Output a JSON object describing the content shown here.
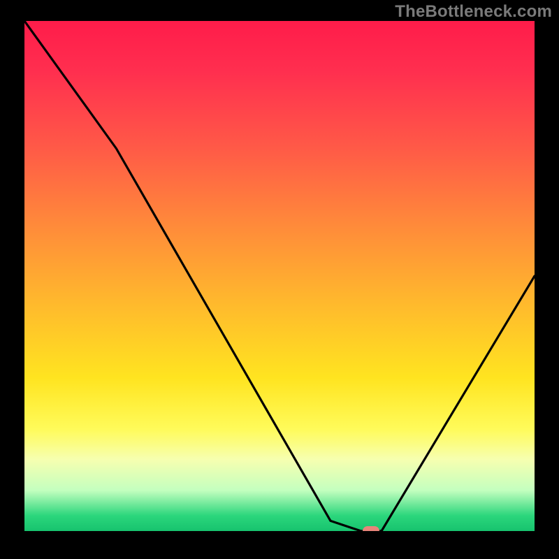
{
  "watermark": "TheBottleneck.com",
  "colors": {
    "curve_stroke": "#000000",
    "marker_fill": "#e8847a",
    "frame_bg": "#000000"
  },
  "chart_data": {
    "type": "line",
    "title": "",
    "xlabel": "",
    "ylabel": "",
    "xlim": [
      0,
      100
    ],
    "ylim": [
      0,
      100
    ],
    "grid": false,
    "series": [
      {
        "name": "bottleneck-curve",
        "x": [
          0,
          18,
          60,
          66,
          70,
          100
        ],
        "values": [
          100,
          75,
          2,
          0,
          0,
          50
        ]
      }
    ],
    "marker": {
      "x": 68,
      "y": 0
    }
  }
}
